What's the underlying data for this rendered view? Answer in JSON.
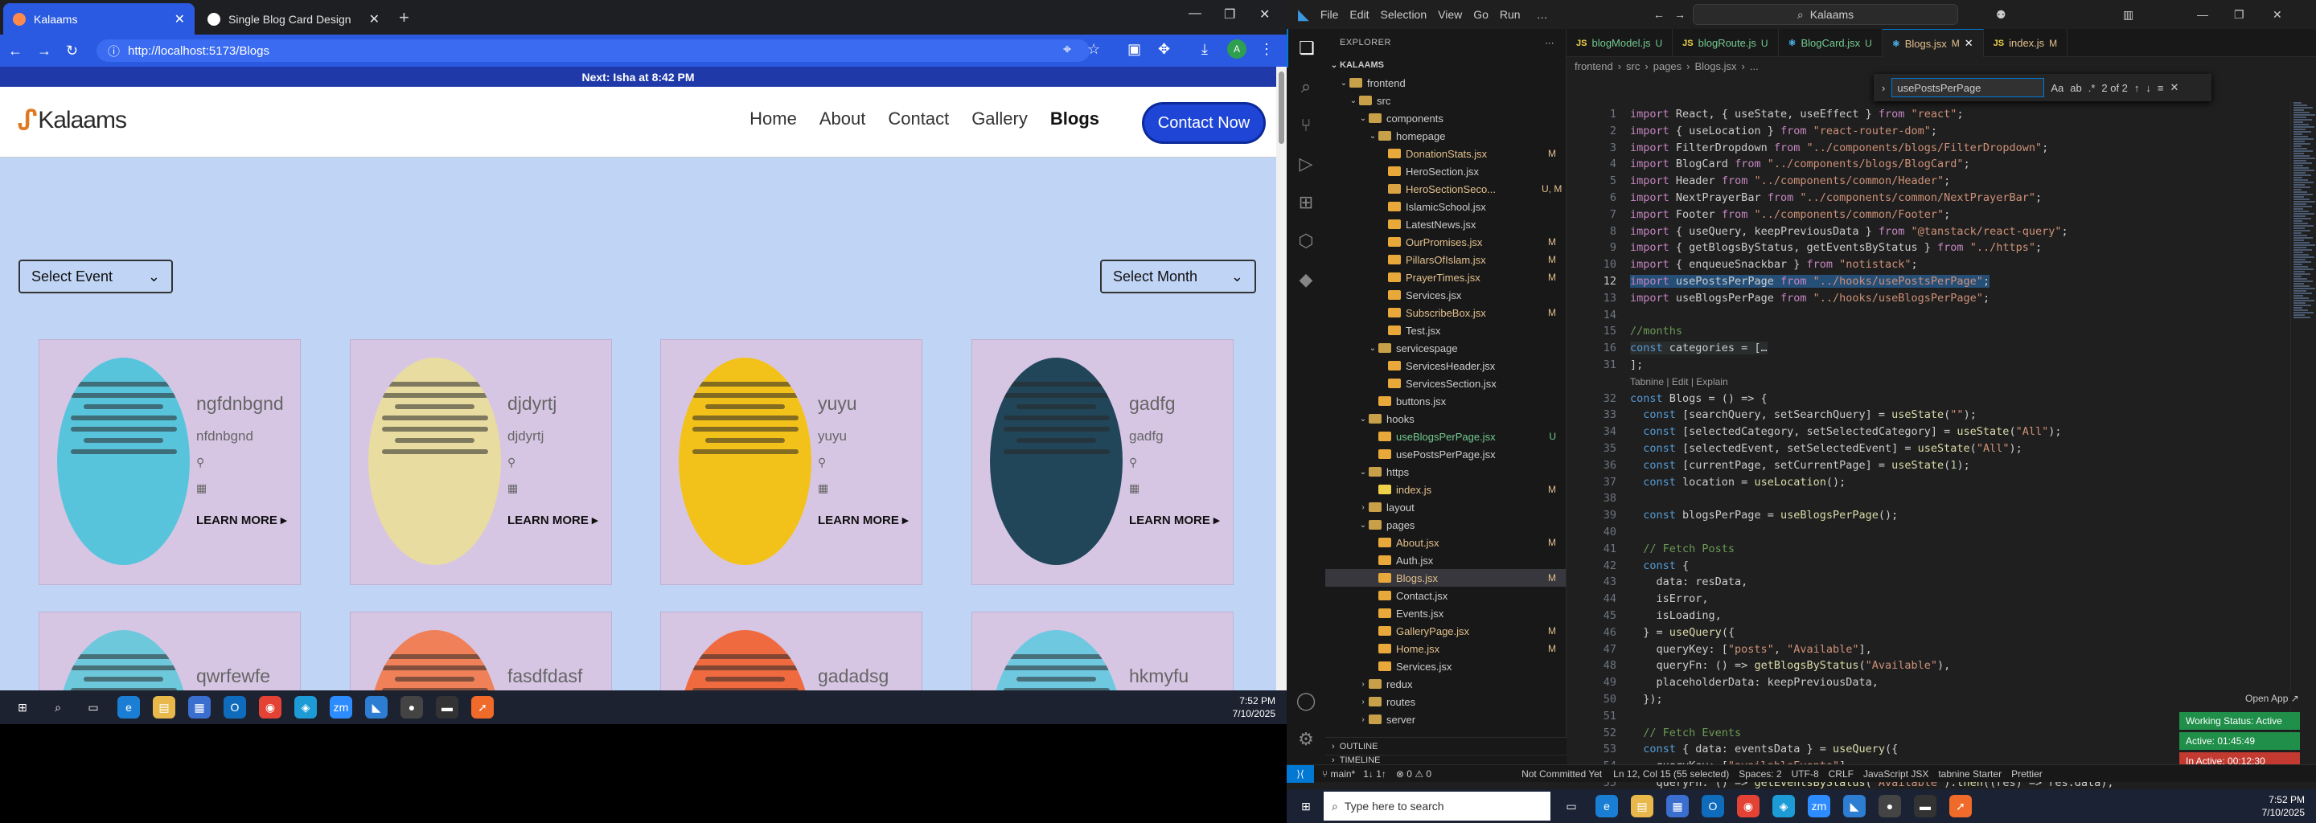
{
  "browser": {
    "tabs": [
      {
        "title": "Kalaams",
        "active": true
      },
      {
        "title": "Single Blog Card Design",
        "active": false
      }
    ],
    "url": "http://localhost:5173/Blogs",
    "avatar_letter": "A"
  },
  "site": {
    "prayer_bar": "Next: Isha at 8:42 PM",
    "logo_text": "Kalaams",
    "menu": [
      "Home",
      "About",
      "Contact",
      "Gallery",
      "Blogs"
    ],
    "active_menu": "Blogs",
    "cta": "Contact Now",
    "select_event": "Select Event",
    "select_month": "Select Month",
    "cards": [
      {
        "title": "ngfdnbgnd",
        "subtitle": "nfdnbgnd",
        "more": "LEARN MORE ▸",
        "bg": "#58c4dc"
      },
      {
        "title": "djdyrtj",
        "subtitle": "djdyrtj",
        "more": "LEARN MORE ▸",
        "bg": "#e8dca0"
      },
      {
        "title": "yuyu",
        "subtitle": "yuyu",
        "more": "LEARN MORE ▸",
        "bg": "#f3c21a"
      },
      {
        "title": "gadfg",
        "subtitle": "gadfg",
        "more": "LEARN MORE ▸",
        "bg": "#21465a"
      },
      {
        "title": "qwrfewfe",
        "bg": "#6ec8dc"
      },
      {
        "title": "fasdfdasf",
        "bg": "#f08058"
      },
      {
        "title": "gadadsg",
        "bg": "#f06a40"
      },
      {
        "title": "hkmyfu",
        "bg": "#6ec8e0"
      }
    ]
  },
  "taskbar_left": {
    "time": "7:52 PM",
    "date": "7/10/2025"
  },
  "taskbar_right": {
    "search_placeholder": "Type here to search",
    "time": "7:52 PM",
    "date": "7/10/2025"
  },
  "vscode": {
    "menu": [
      "File",
      "Edit",
      "Selection",
      "View",
      "Go",
      "Run"
    ],
    "search": "Kalaams",
    "explorer_title": "EXPLORER",
    "root": "KALAAMS",
    "tree": [
      {
        "name": "frontend",
        "type": "folder",
        "depth": 1,
        "open": true,
        "status": ""
      },
      {
        "name": "src",
        "type": "folder",
        "depth": 2,
        "open": true,
        "status": ""
      },
      {
        "name": "components",
        "type": "folder",
        "depth": 3,
        "open": true,
        "status": ""
      },
      {
        "name": "homepage",
        "type": "folder",
        "depth": 4,
        "open": true,
        "status": ""
      },
      {
        "name": "DonationStats.jsx",
        "type": "file",
        "depth": 5,
        "status": "M"
      },
      {
        "name": "HeroSection.jsx",
        "type": "file",
        "depth": 5,
        "status": ""
      },
      {
        "name": "HeroSectionSeco...",
        "type": "file",
        "depth": 5,
        "status": "U, M"
      },
      {
        "name": "IslamicSchool.jsx",
        "type": "file",
        "depth": 5,
        "status": ""
      },
      {
        "name": "LatestNews.jsx",
        "type": "file",
        "depth": 5,
        "status": ""
      },
      {
        "name": "OurPromises.jsx",
        "type": "file",
        "depth": 5,
        "status": "M"
      },
      {
        "name": "PillarsOfIslam.jsx",
        "type": "file",
        "depth": 5,
        "status": "M"
      },
      {
        "name": "PrayerTimes.jsx",
        "type": "file",
        "depth": 5,
        "status": "M"
      },
      {
        "name": "Services.jsx",
        "type": "file",
        "depth": 5,
        "status": ""
      },
      {
        "name": "SubscribeBox.jsx",
        "type": "file",
        "depth": 5,
        "status": "M"
      },
      {
        "name": "Test.jsx",
        "type": "file",
        "depth": 5,
        "status": ""
      },
      {
        "name": "servicespage",
        "type": "folder",
        "depth": 4,
        "open": true,
        "status": ""
      },
      {
        "name": "ServicesHeader.jsx",
        "type": "file",
        "depth": 5,
        "status": ""
      },
      {
        "name": "ServicesSection.jsx",
        "type": "file",
        "depth": 5,
        "status": ""
      },
      {
        "name": "buttons.jsx",
        "type": "file",
        "depth": 4,
        "status": ""
      },
      {
        "name": "hooks",
        "type": "folder",
        "depth": 3,
        "open": true,
        "status": ""
      },
      {
        "name": "useBlogsPerPage.jsx",
        "type": "file",
        "depth": 4,
        "status": "U"
      },
      {
        "name": "usePostsPerPage.jsx",
        "type": "file",
        "depth": 4,
        "status": ""
      },
      {
        "name": "https",
        "type": "folder",
        "depth": 3,
        "open": true,
        "status": ""
      },
      {
        "name": "index.js",
        "type": "file",
        "depth": 4,
        "status": "M"
      },
      {
        "name": "layout",
        "type": "folder",
        "depth": 3,
        "open": false,
        "status": ""
      },
      {
        "name": "pages",
        "type": "folder",
        "depth": 3,
        "open": true,
        "status": ""
      },
      {
        "name": "About.jsx",
        "type": "file",
        "depth": 4,
        "status": "M"
      },
      {
        "name": "Auth.jsx",
        "type": "file",
        "depth": 4,
        "status": ""
      },
      {
        "name": "Blogs.jsx",
        "type": "file",
        "depth": 4,
        "status": "M",
        "selected": true
      },
      {
        "name": "Contact.jsx",
        "type": "file",
        "depth": 4,
        "status": ""
      },
      {
        "name": "Events.jsx",
        "type": "file",
        "depth": 4,
        "status": ""
      },
      {
        "name": "GalleryPage.jsx",
        "type": "file",
        "depth": 4,
        "status": "M"
      },
      {
        "name": "Home.jsx",
        "type": "file",
        "depth": 4,
        "status": "M"
      },
      {
        "name": "Services.jsx",
        "type": "file",
        "depth": 4,
        "status": ""
      },
      {
        "name": "redux",
        "type": "folder",
        "depth": 3,
        "open": false,
        "status": ""
      },
      {
        "name": "routes",
        "type": "folder",
        "depth": 3,
        "open": false,
        "status": ""
      },
      {
        "name": "server",
        "type": "folder",
        "depth": 3,
        "open": false,
        "status": ""
      }
    ],
    "outline": "OUTLINE",
    "timeline": "TIMELINE",
    "tabs": [
      {
        "name": "blogModel.js",
        "mark": "U",
        "active": false
      },
      {
        "name": "blogRoute.js",
        "mark": "U",
        "active": false
      },
      {
        "name": "BlogCard.jsx",
        "mark": "U",
        "active": false
      },
      {
        "name": "Blogs.jsx",
        "mark": "M",
        "active": true
      },
      {
        "name": "index.js",
        "mark": "M",
        "active": false
      }
    ],
    "breadcrumb": [
      "frontend",
      "src",
      "pages",
      "Blogs.jsx",
      "..."
    ],
    "find": {
      "value": "usePostsPerPage",
      "count": "2 of 2"
    },
    "code_lines": [
      {
        "n": "1",
        "t": "import React, { useState, useEffect } from \"react\";"
      },
      {
        "n": "2",
        "t": "import { useLocation } from \"react-router-dom\";"
      },
      {
        "n": "3",
        "t": "import FilterDropdown from \"../components/blogs/FilterDropdown\";"
      },
      {
        "n": "4",
        "t": "import BlogCard from \"../components/blogs/BlogCard\";"
      },
      {
        "n": "5",
        "t": "import Header from \"../components/common/Header\";"
      },
      {
        "n": "6",
        "t": "import NextPrayerBar from \"../components/common/NextPrayerBar\";"
      },
      {
        "n": "7",
        "t": "import Footer from \"../components/common/Footer\";"
      },
      {
        "n": "8",
        "t": "import { useQuery, keepPreviousData } from \"@tanstack/react-query\";"
      },
      {
        "n": "9",
        "t": "import { getBlogsByStatus, getEventsByStatus } from \"../https\";"
      },
      {
        "n": "10",
        "t": "import { enqueueSnackbar } from \"notistack\";"
      },
      {
        "n": "12",
        "t": "import usePostsPerPage from \"../hooks/usePostsPerPage\";"
      },
      {
        "n": "13",
        "t": "import useBlogsPerPage from \"../hooks/useBlogsPerPage\";"
      },
      {
        "n": "14",
        "t": ""
      },
      {
        "n": "15",
        "t": "//months"
      },
      {
        "n": "16",
        "t": "const categories = […"
      },
      {
        "n": "31",
        "t": "];"
      },
      {
        "n": "",
        "t": "Tabnine | Edit | Explain"
      },
      {
        "n": "32",
        "t": "const Blogs = () => {"
      },
      {
        "n": "33",
        "t": "  const [searchQuery, setSearchQuery] = useState(\"\");"
      },
      {
        "n": "34",
        "t": "  const [selectedCategory, setSelectedCategory] = useState(\"All\");"
      },
      {
        "n": "35",
        "t": "  const [selectedEvent, setSelectedEvent] = useState(\"All\");"
      },
      {
        "n": "36",
        "t": "  const [currentPage, setCurrentPage] = useState(1);"
      },
      {
        "n": "37",
        "t": "  const location = useLocation();"
      },
      {
        "n": "38",
        "t": ""
      },
      {
        "n": "39",
        "t": "  const blogsPerPage = useBlogsPerPage();"
      },
      {
        "n": "40",
        "t": ""
      },
      {
        "n": "41",
        "t": "  // Fetch Posts"
      },
      {
        "n": "42",
        "t": "  const {"
      },
      {
        "n": "43",
        "t": "    data: resData,"
      },
      {
        "n": "44",
        "t": "    isError,"
      },
      {
        "n": "45",
        "t": "    isLoading,"
      },
      {
        "n": "46",
        "t": "  } = useQuery({"
      },
      {
        "n": "47",
        "t": "    queryKey: [\"posts\", \"Available\"],"
      },
      {
        "n": "48",
        "t": "    queryFn: () => getBlogsByStatus(\"Available\"),"
      },
      {
        "n": "49",
        "t": "    placeholderData: keepPreviousData,"
      },
      {
        "n": "50",
        "t": "  });"
      },
      {
        "n": "51",
        "t": ""
      },
      {
        "n": "52",
        "t": "  // Fetch Events"
      },
      {
        "n": "53",
        "t": "  const { data: eventsData } = useQuery({"
      },
      {
        "n": "54",
        "t": "    queryKey: [\"availableEvents\"],"
      },
      {
        "n": "55",
        "t": "    queryFn: () => getEventsByStatus(\"Available\").then((res) => res.data),"
      },
      {
        "n": "56",
        "t": "  });"
      }
    ],
    "status": {
      "branch": "main*",
      "sync": "1↓ 1↑",
      "problems": "⊗ 0 ⚠ 0",
      "commit": "Not Committed Yet",
      "position": "Ln 12, Col 15 (55 selected)",
      "spaces": "Spaces: 2",
      "encoding": "UTF-8",
      "eol": "CRLF",
      "lang": "JavaScript JSX",
      "tabnine": "tabnine Starter",
      "prettier": "Prettier"
    },
    "open_app": "Open App ↗",
    "working": {
      "status": "Working Status: Active",
      "active": "Active: 01:45:49",
      "inactive": "In Active: 00:12:30"
    }
  }
}
